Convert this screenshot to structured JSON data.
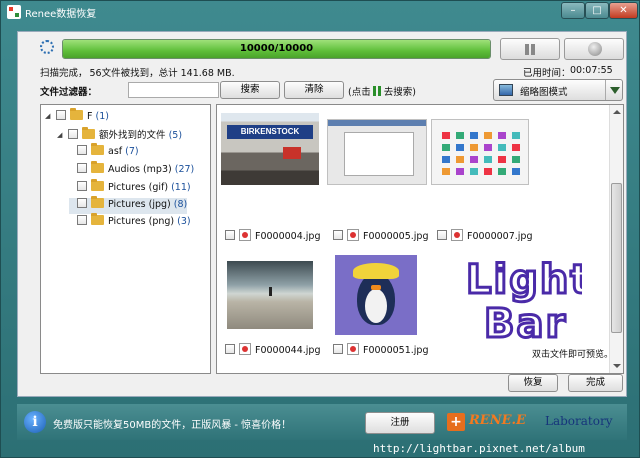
{
  "window": {
    "title": "Renee数据恢复",
    "controls": {
      "minimize": "–",
      "maximize": "□",
      "close": "✕"
    }
  },
  "scan": {
    "progress_text": "10000/10000",
    "progress_fraction": 1.0,
    "status_done": "扫描完成，",
    "status_files": "56文件被找到，总计 141.68 MB.",
    "elapsed_label": "已用时间：",
    "elapsed_value": "00:07:55"
  },
  "filter": {
    "label": "文件过滤器：",
    "value": "",
    "search_label": "搜索",
    "clear_label": "清除",
    "hint_prefix": "(点击",
    "hint_suffix": "去搜索)"
  },
  "view_mode": {
    "label": "缩略图模式",
    "icon": "thumbnail-icon"
  },
  "tree": [
    {
      "name": "F",
      "count": "(1)",
      "indent": 0,
      "twisty": "◢"
    },
    {
      "name": "额外找到的文件",
      "count": "(5)",
      "indent": 1,
      "twisty": "◢"
    },
    {
      "name": "asf",
      "count": "(7)",
      "indent": 2,
      "twisty": ""
    },
    {
      "name": "Audios (mp3)",
      "count": "(27)",
      "indent": 2,
      "twisty": ""
    },
    {
      "name": "Pictures (gif)",
      "count": "(11)",
      "indent": 2,
      "twisty": ""
    },
    {
      "name": "Pictures (jpg)",
      "count": "(8)",
      "indent": 2,
      "twisty": "",
      "selected": true
    },
    {
      "name": "Pictures (png)",
      "count": "(3)",
      "indent": 2,
      "twisty": ""
    }
  ],
  "thumbnails": [
    {
      "file": "F0000004.jpg",
      "sign_text": "BIRKENSTOCK"
    },
    {
      "file": "F0000005.jpg"
    },
    {
      "file": "F0000007.jpg"
    },
    {
      "file": "F0000044.jpg"
    },
    {
      "file": "F0000051.jpg"
    },
    {
      "file": "",
      "logo_line1": "Light",
      "logo_line2": "Bar"
    }
  ],
  "preview_hint": "双击文件即可预览。",
  "actions": {
    "restore_label": "恢复",
    "finish_label": "完成"
  },
  "footer": {
    "free_message": "免费版只能恢复50MB的文件，正版风暴 - 惊喜价格！",
    "register_label": "注册",
    "brand_name": "RENE.E",
    "brand_sub": "Laboratory"
  },
  "watermark": "http://lightbar.pixnet.net/album",
  "colors": {
    "progress": "#5fbf3a",
    "brand": "#f47a1f",
    "logo_purple": "#4a2aa8"
  }
}
